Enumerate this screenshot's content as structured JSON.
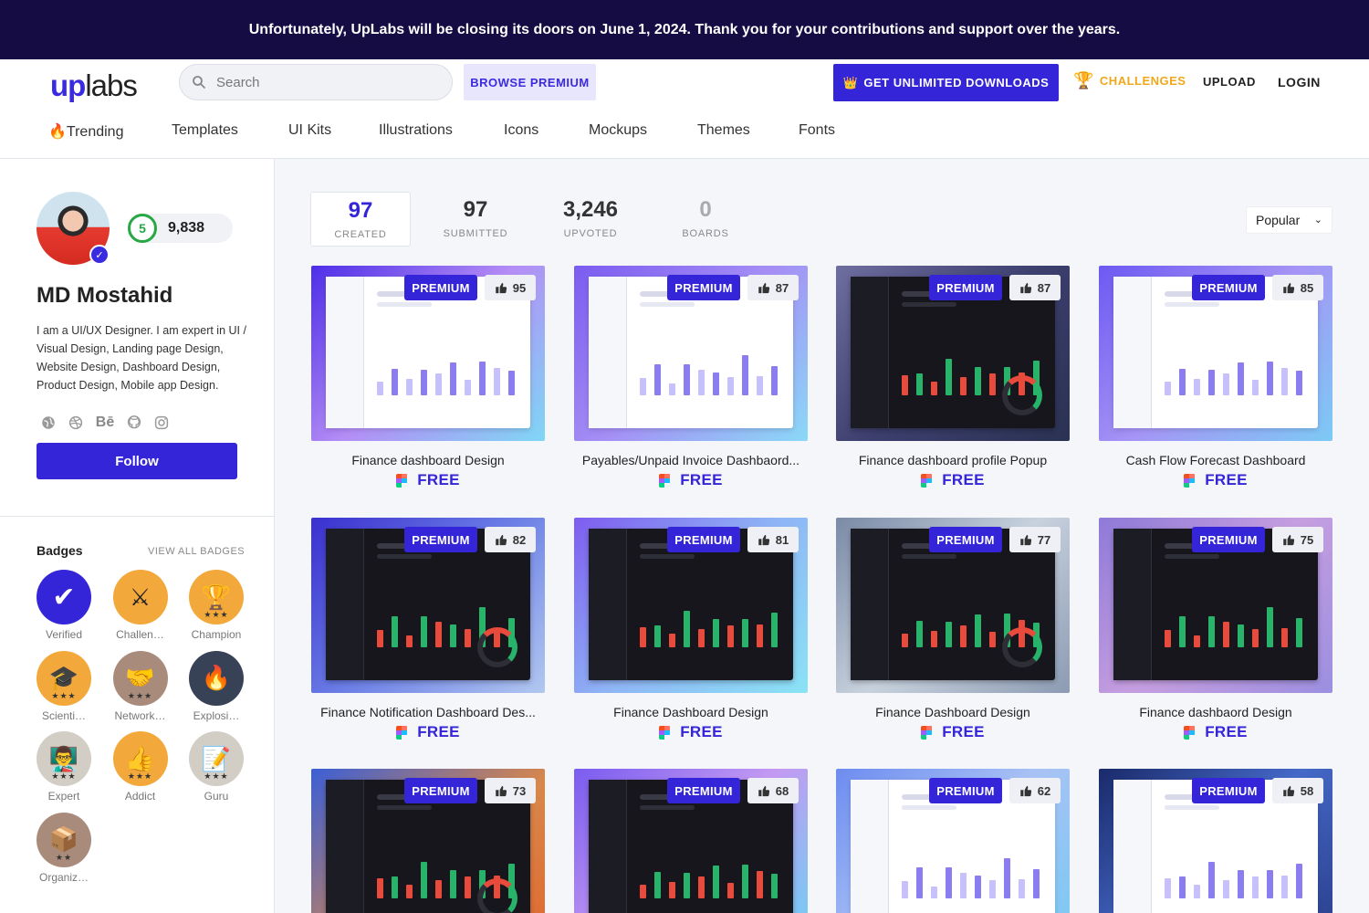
{
  "banner": {
    "text": "Unfortunately, UpLabs will be closing its doors on June 1, 2024. Thank you for your contributions and support over the years."
  },
  "header": {
    "logo_up": "up",
    "logo_labs": "labs",
    "search_placeholder": "Search",
    "browse_premium": "BROWSE PREMIUM",
    "unlimited": "GET UNLIMITED DOWNLOADS",
    "challenges": "CHALLENGES",
    "upload": "UPLOAD",
    "login": "LOGIN",
    "nav": [
      "🔥Trending",
      "Templates",
      "UI Kits",
      "Illustrations",
      "Icons",
      "Mockups",
      "Themes",
      "Fonts"
    ]
  },
  "profile": {
    "level": "5",
    "points": "9,838",
    "name": "MD Mostahid",
    "bio": "I am a UI/UX Designer. I am expert in UI / Visual Design, Landing page Design, Website Design, Dashboard Design, Product Design, Mobile app Design.",
    "socials": [
      "globe-icon",
      "dribbble-icon",
      "behance-icon",
      "github-icon",
      "instagram-icon"
    ],
    "behance_label": "Bē",
    "follow": "Follow"
  },
  "badges": {
    "title": "Badges",
    "view_all": "VIEW ALL BADGES",
    "items": [
      {
        "label": "Verified",
        "icon": "✔",
        "color": "#3425d8",
        "stars": ""
      },
      {
        "label": "Challenger",
        "icon": "⚔",
        "color": "#f2a83a",
        "stars": ""
      },
      {
        "label": "Champion",
        "icon": "🏆",
        "color": "#f2a83a",
        "stars": "★★★"
      },
      {
        "label": "Scientist",
        "icon": "🎓",
        "color": "#f2a83a",
        "stars": "★★★"
      },
      {
        "label": "Networker",
        "icon": "🤝",
        "color": "#a98b7c",
        "stars": "★★★"
      },
      {
        "label": "Explosive",
        "icon": "🔥",
        "color": "#374256",
        "stars": ""
      },
      {
        "label": "Expert",
        "icon": "👨‍🏫",
        "color": "#d2cdc5",
        "stars": "★★★"
      },
      {
        "label": "Addict",
        "icon": "👍",
        "color": "#f2a83a",
        "stars": "★★★"
      },
      {
        "label": "Guru",
        "icon": "📝",
        "color": "#d2cdc5",
        "stars": "★★★"
      },
      {
        "label": "Organizer",
        "icon": "📦",
        "color": "#a98b7c",
        "stars": "★★"
      }
    ]
  },
  "stats": [
    {
      "value": "97",
      "label": "CREATED"
    },
    {
      "value": "97",
      "label": "SUBMITTED"
    },
    {
      "value": "3,246",
      "label": "UPVOTED"
    },
    {
      "value": "0",
      "label": "BOARDS"
    }
  ],
  "sort": {
    "selected": "Popular"
  },
  "cards": [
    {
      "title": "Finance dashboard Design",
      "likes": "95",
      "badge": "PREMIUM",
      "price": "FREE",
      "theme": "light",
      "bg": "linear-gradient(135deg,#4d2ee8,#b48df5 50%,#7fd7f5)"
    },
    {
      "title": "Payables/Unpaid Invoice Dashbaord...",
      "likes": "87",
      "badge": "PREMIUM",
      "price": "FREE",
      "theme": "light",
      "bg": "linear-gradient(135deg,#7a5cf0,#a58ff5 50%,#8ad9f7)"
    },
    {
      "title": "Finance dashboard profile Popup",
      "likes": "87",
      "badge": "PREMIUM",
      "price": "FREE",
      "theme": "dark",
      "bg": "linear-gradient(135deg,#6f6ea0,#3d3f6e 50%,#2a3252)"
    },
    {
      "title": "Cash Flow Forecast Dashboard",
      "likes": "85",
      "badge": "PREMIUM",
      "price": "FREE",
      "theme": "light",
      "bg": "linear-gradient(135deg,#6d59f2,#a694f5 50%,#7ccaf5)"
    },
    {
      "title": "Finance Notification Dashboard Des...",
      "likes": "82",
      "badge": "PREMIUM",
      "price": "FREE",
      "theme": "dark",
      "bg": "linear-gradient(135deg,#3a2fd0,#6b7ee6 50%,#b2c8f0)"
    },
    {
      "title": "Finance Dashboard Design",
      "likes": "81",
      "badge": "PREMIUM",
      "price": "FREE",
      "theme": "dark",
      "bg": "linear-gradient(135deg,#7e5cf0,#8fb4f5 50%,#8ae3f5)"
    },
    {
      "title": "Finance Dashboard Design",
      "likes": "77",
      "badge": "PREMIUM",
      "price": "FREE",
      "theme": "dark",
      "bg": "linear-gradient(135deg,#7a8aa6,#c8d2de 50%,#8c9bb3)"
    },
    {
      "title": "Finance dashbaord Design",
      "likes": "75",
      "badge": "PREMIUM",
      "price": "FREE",
      "theme": "dark",
      "bg": "linear-gradient(135deg,#8e7ad8,#c69ee0 50%,#9b8fe0)"
    },
    {
      "title": "",
      "likes": "73",
      "badge": "PREMIUM",
      "price": "",
      "theme": "dark",
      "bg": "linear-gradient(135deg,#3b5fd6,#d9874a 60%,#e0682f)"
    },
    {
      "title": "",
      "likes": "68",
      "badge": "PREMIUM",
      "price": "",
      "theme": "dark",
      "bg": "linear-gradient(135deg,#7a5cf0,#c39af2 50%,#6fd0f5)"
    },
    {
      "title": "",
      "likes": "62",
      "badge": "PREMIUM",
      "price": "",
      "theme": "light",
      "bg": "linear-gradient(135deg,#6d8cf0,#a9c2f5 50%,#79c9f2)"
    },
    {
      "title": "",
      "likes": "58",
      "badge": "PREMIUM",
      "price": "",
      "theme": "light",
      "bg": "linear-gradient(135deg,#1a2a6a,#4569c8 50%,#2a3d8a)"
    }
  ],
  "colors": {
    "brand": "#3425d8",
    "banner": "#150c44",
    "challenges": "#f0a81a",
    "level": "#27a844"
  }
}
